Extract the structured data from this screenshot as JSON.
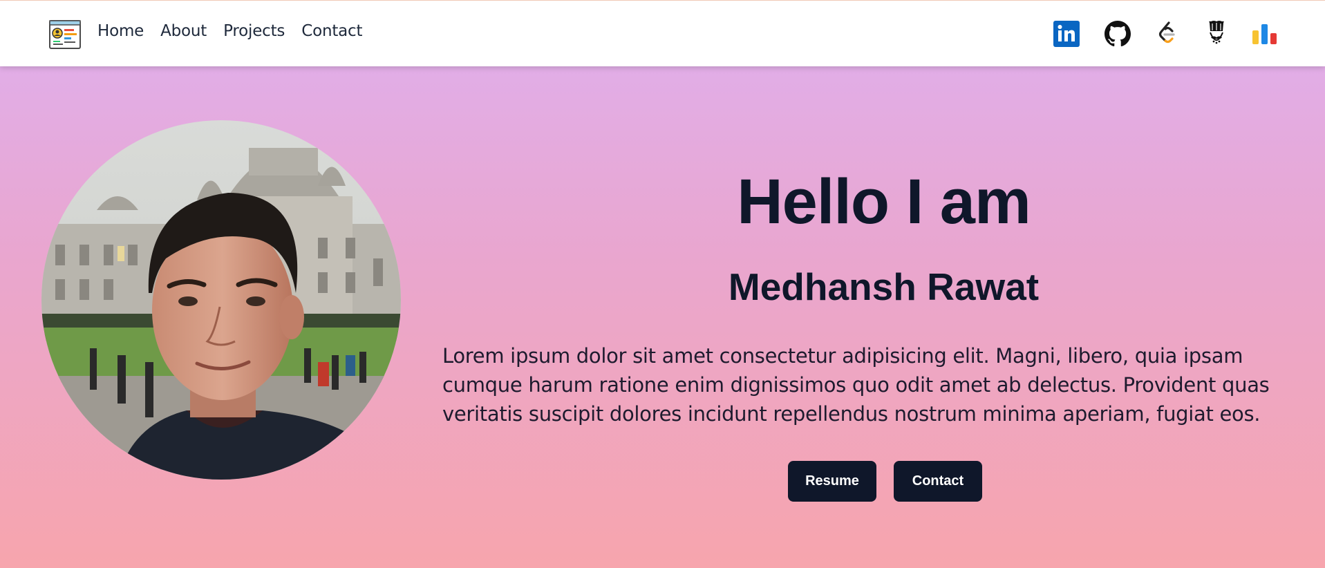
{
  "nav": {
    "logo_icon": "portfolio-logo-icon",
    "links": [
      {
        "label": "Home"
      },
      {
        "label": "About"
      },
      {
        "label": "Projects"
      },
      {
        "label": "Contact"
      }
    ],
    "social_icons": [
      "linkedin-icon",
      "github-icon",
      "leetcode-icon",
      "codechef-icon",
      "codeforces-icon"
    ]
  },
  "hero": {
    "photo": "profile-photo",
    "greeting": "Hello I am",
    "name": "Medhansh Rawat",
    "description": "Lorem ipsum dolor sit amet consectetur adipisicing elit. Magni, libero, quia ipsam cumque harum ratione enim dignissimos quo odit amet ab delectus. Provident quas veritatis suscipit dolores incidunt repellendus nostrum minima aperiam, fugiat eos.",
    "buttons": {
      "resume": "Resume",
      "contact": "Contact"
    }
  },
  "colors": {
    "gradient_top": "#dfb0ef",
    "gradient_bottom": "#f7a5ad",
    "text_dark": "#0f172a",
    "button_bg": "#0f172a",
    "linkedin": "#0a66c2"
  }
}
